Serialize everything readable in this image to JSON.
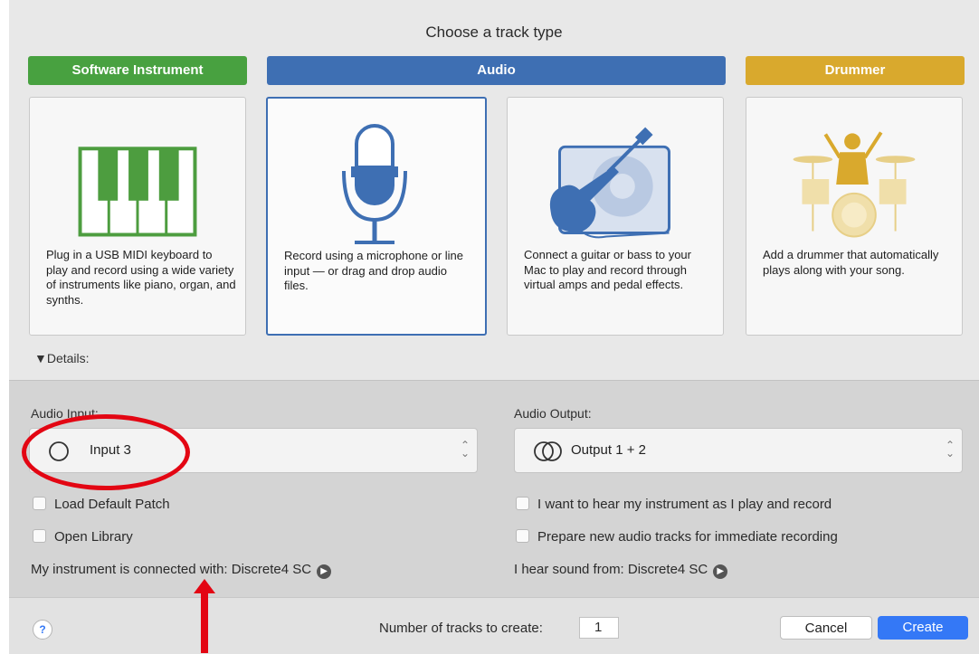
{
  "title": "Choose a track type",
  "track_types": [
    {
      "label": "Software Instrument",
      "color": "#48a140",
      "desc": "Plug in a USB MIDI keyboard to play and record using a wide variety of instruments like piano, organ, and synths."
    },
    {
      "label": "Audio",
      "color": "#3e6fb3",
      "desc": "Record using a microphone or line input — or drag and drop audio files."
    },
    {
      "label": "",
      "color": "",
      "desc": "Connect a guitar or bass to your Mac to play and record through virtual amps and pedal effects."
    },
    {
      "label": "Drummer",
      "color": "#d9a92d",
      "desc": "Add a drummer that automatically plays along with your song."
    }
  ],
  "selected_type": "Audio",
  "details_label": "▼Details:",
  "audio_input": {
    "label": "Audio Input:",
    "value": "Input 3",
    "icon": "mono-circle-icon"
  },
  "audio_output": {
    "label": "Audio Output:",
    "value": "Output 1 + 2",
    "icon": "stereo-circles-icon"
  },
  "checkboxes_left": [
    "Load Default Patch",
    "Open Library"
  ],
  "checkboxes_right": [
    "I want to hear my instrument as I play and record",
    "Prepare new audio tracks for immediate recording"
  ],
  "connected_with": "My instrument is connected with: Discrete4 SC",
  "hear_from": "I hear sound from: Discrete4 SC",
  "footer": {
    "help": "?",
    "tracks_label": "Number of tracks to create:",
    "tracks_value": "1",
    "cancel": "Cancel",
    "create": "Create"
  },
  "annotation_color": "#e30613"
}
